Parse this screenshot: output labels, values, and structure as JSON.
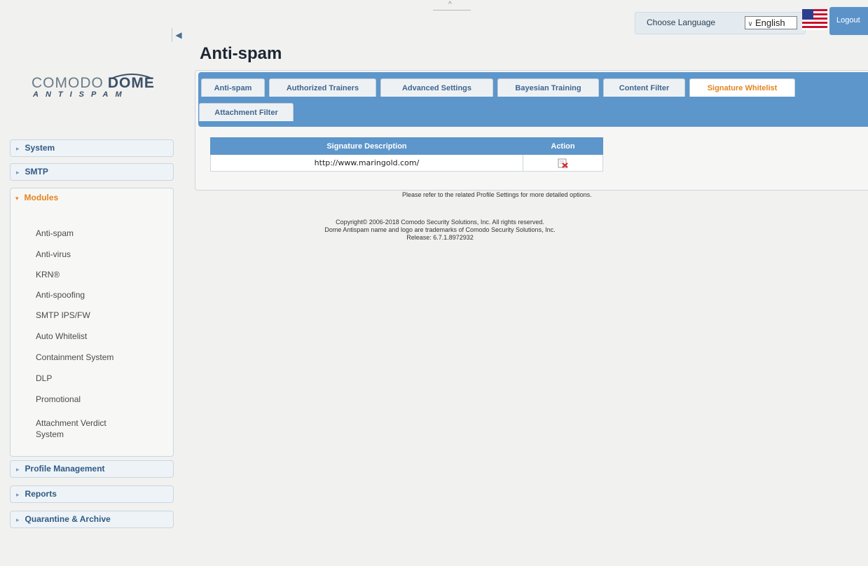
{
  "logo": {
    "brand": "COMODO",
    "product": "DOME",
    "tagline": "ANTISPAM"
  },
  "header": {
    "language_label": "Choose Language",
    "language_value": "English",
    "logout_label": "Logout"
  },
  "page": {
    "title": "Anti-spam"
  },
  "tabs": [
    {
      "label": "Anti-spam"
    },
    {
      "label": "Authorized Trainers"
    },
    {
      "label": "Advanced Settings"
    },
    {
      "label": "Bayesian Training"
    },
    {
      "label": "Content Filter"
    },
    {
      "label": "Signature Whitelist",
      "active": true
    },
    {
      "label": "Attachment Filter"
    }
  ],
  "table": {
    "columns": [
      "Signature Description",
      "Action"
    ],
    "rows": [
      {
        "signature": "http://www.maringold.com/"
      }
    ]
  },
  "note": "Please refer to the related Profile Settings for more detailed options.",
  "footer": {
    "copyright": "Copyright© 2006-2018 Comodo Security Solutions, Inc. All rights reserved.",
    "trademark": "Dome Antispam name and logo are trademarks of Comodo Security Solutions, Inc.",
    "release": "Release: 6.7.1.8972932"
  },
  "sidebar": {
    "sections": [
      {
        "label": "System"
      },
      {
        "label": "SMTP"
      },
      {
        "label": "Modules",
        "open": true
      },
      {
        "label": "Profile Management"
      },
      {
        "label": "Reports"
      },
      {
        "label": "Quarantine & Archive"
      }
    ],
    "modules": [
      {
        "label": "Anti-spam"
      },
      {
        "label": "Anti-virus"
      },
      {
        "label": "KRN®"
      },
      {
        "label": "Anti-spoofing"
      },
      {
        "label": "SMTP IPS/FW"
      },
      {
        "label": "Auto Whitelist"
      },
      {
        "label": "Containment System"
      },
      {
        "label": "DLP"
      },
      {
        "label": "Promotional"
      },
      {
        "label": "Attachment Verdict System"
      }
    ]
  },
  "colors": {
    "accent": "#5c96cb",
    "active_tab": "#e5841e",
    "link": "#2f5a84"
  },
  "icons": {
    "collapse": "arrow-left-icon",
    "delete": "delete-icon",
    "flag": "us-flag-icon"
  }
}
